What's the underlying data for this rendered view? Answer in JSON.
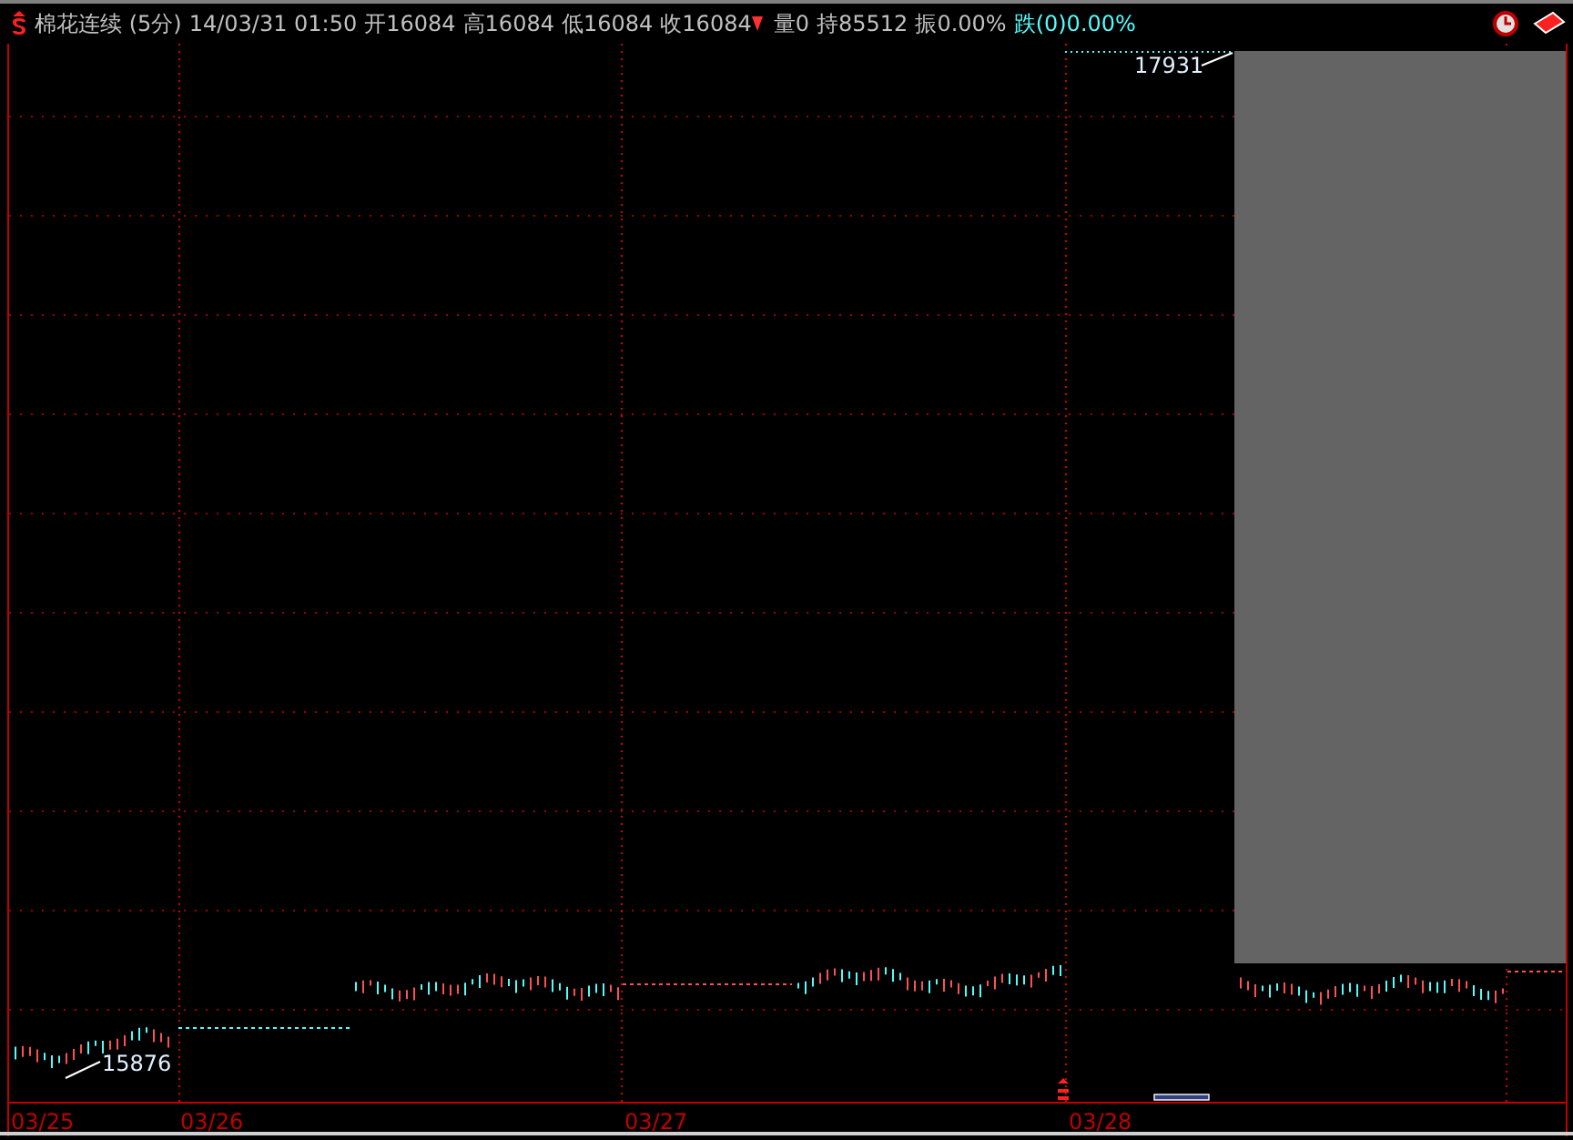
{
  "header": {
    "title": "棉花连续 (5分)",
    "datetime": "14/03/31 01:50",
    "quotes": [
      {
        "text": "开16084"
      },
      {
        "text": "高16084"
      },
      {
        "text": "低16084"
      },
      {
        "text": "收16084",
        "falling": true
      },
      {
        "text": "量0"
      },
      {
        "text": "持85512"
      },
      {
        "text": "振0.00%"
      }
    ],
    "change": "跌(0)0.00%"
  },
  "chart": {
    "high_label": "17931",
    "low_label": "15876"
  },
  "x_axis": {
    "dates": [
      "03/25",
      "03/26",
      "03/27",
      "03/28"
    ]
  }
}
